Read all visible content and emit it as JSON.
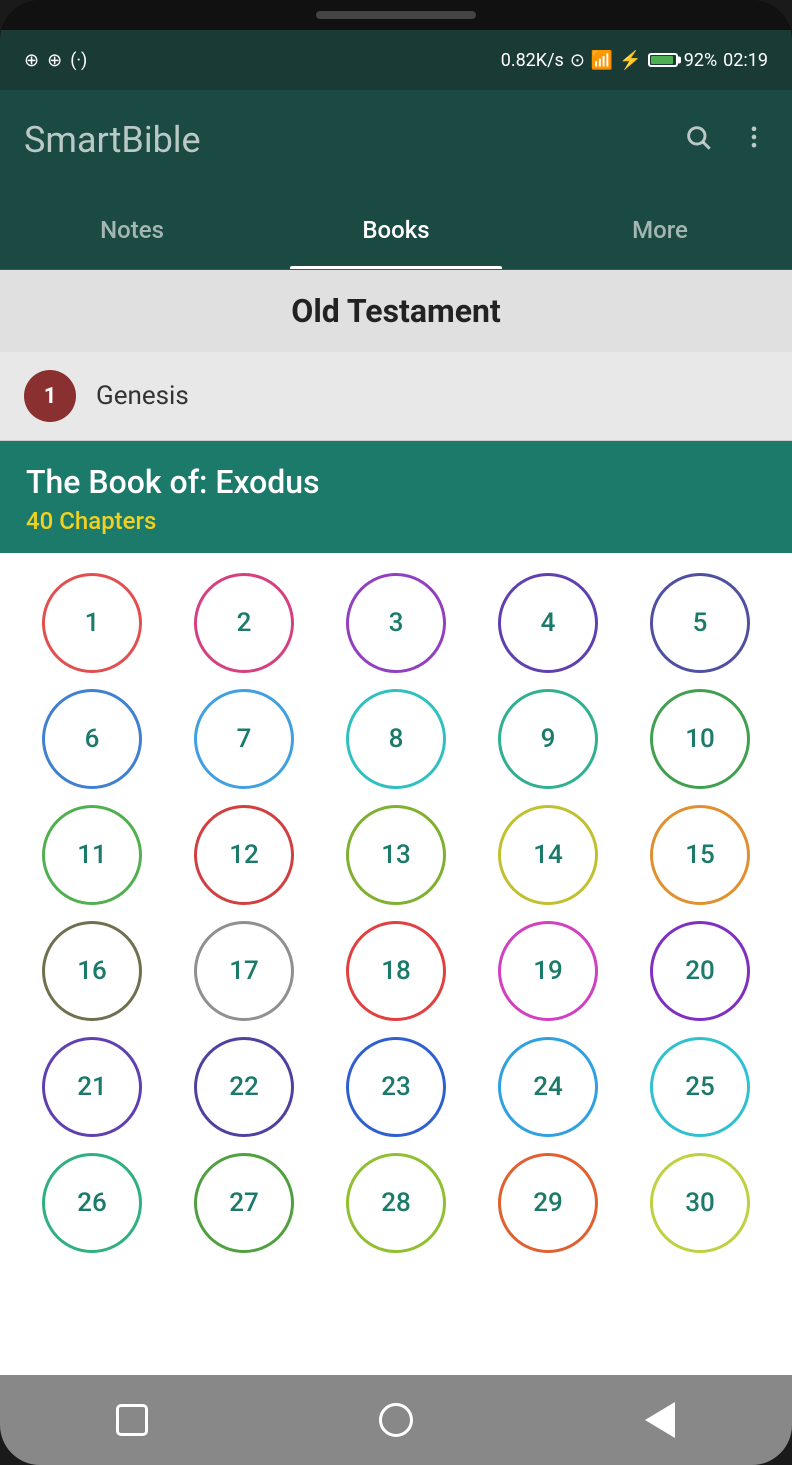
{
  "statusBar": {
    "leftIcons": "⊕ ⊕ (·)",
    "speed": "0.82K/s",
    "network": "4G",
    "battery": "92%",
    "time": "02:19"
  },
  "appBar": {
    "title": "SmartBible",
    "searchIcon": "search",
    "menuIcon": "more-vert"
  },
  "tabs": [
    {
      "label": "Notes",
      "active": false
    },
    {
      "label": "Books",
      "active": true
    },
    {
      "label": "More",
      "active": false
    }
  ],
  "testament": {
    "title": "Old Testament"
  },
  "genesisRow": {
    "number": "1",
    "label": "Genesis"
  },
  "exodusSection": {
    "title": "The Book of: Exodus",
    "chapters": "40 Chapters"
  },
  "chapterCircles": [
    {
      "num": 1,
      "color": "#e05050"
    },
    {
      "num": 2,
      "color": "#d44080"
    },
    {
      "num": 3,
      "color": "#9040c0"
    },
    {
      "num": 4,
      "color": "#6040b0"
    },
    {
      "num": 5,
      "color": "#5050a0"
    },
    {
      "num": 6,
      "color": "#4080d0"
    },
    {
      "num": 7,
      "color": "#40a0e0"
    },
    {
      "num": 8,
      "color": "#30c0c0"
    },
    {
      "num": 9,
      "color": "#30b090"
    },
    {
      "num": 10,
      "color": "#40a050"
    },
    {
      "num": 11,
      "color": "#50b050"
    },
    {
      "num": 12,
      "color": "#d04040"
    },
    {
      "num": 13,
      "color": "#80b030"
    },
    {
      "num": 14,
      "color": "#c0c030"
    },
    {
      "num": 15,
      "color": "#e09030"
    },
    {
      "num": 16,
      "color": "#707050"
    },
    {
      "num": 17,
      "color": "#909090"
    },
    {
      "num": 18,
      "color": "#e04040"
    },
    {
      "num": 19,
      "color": "#d040c0"
    },
    {
      "num": 20,
      "color": "#8030c0"
    },
    {
      "num": 21,
      "color": "#6040b0"
    },
    {
      "num": 22,
      "color": "#5040a0"
    },
    {
      "num": 23,
      "color": "#3060d0"
    },
    {
      "num": 24,
      "color": "#30a0e0"
    },
    {
      "num": 25,
      "color": "#30c0d0"
    },
    {
      "num": 26,
      "color": "#30b080"
    },
    {
      "num": 27,
      "color": "#50a040"
    },
    {
      "num": 28,
      "color": "#90c030"
    },
    {
      "num": 29,
      "color": "#e06030"
    },
    {
      "num": 30,
      "color": "#c0d040"
    }
  ],
  "chapterTextColor": "#1b7a6a",
  "navBar": {
    "squareBtn": "recent-apps",
    "circleBtn": "home",
    "triangleBtn": "back"
  }
}
